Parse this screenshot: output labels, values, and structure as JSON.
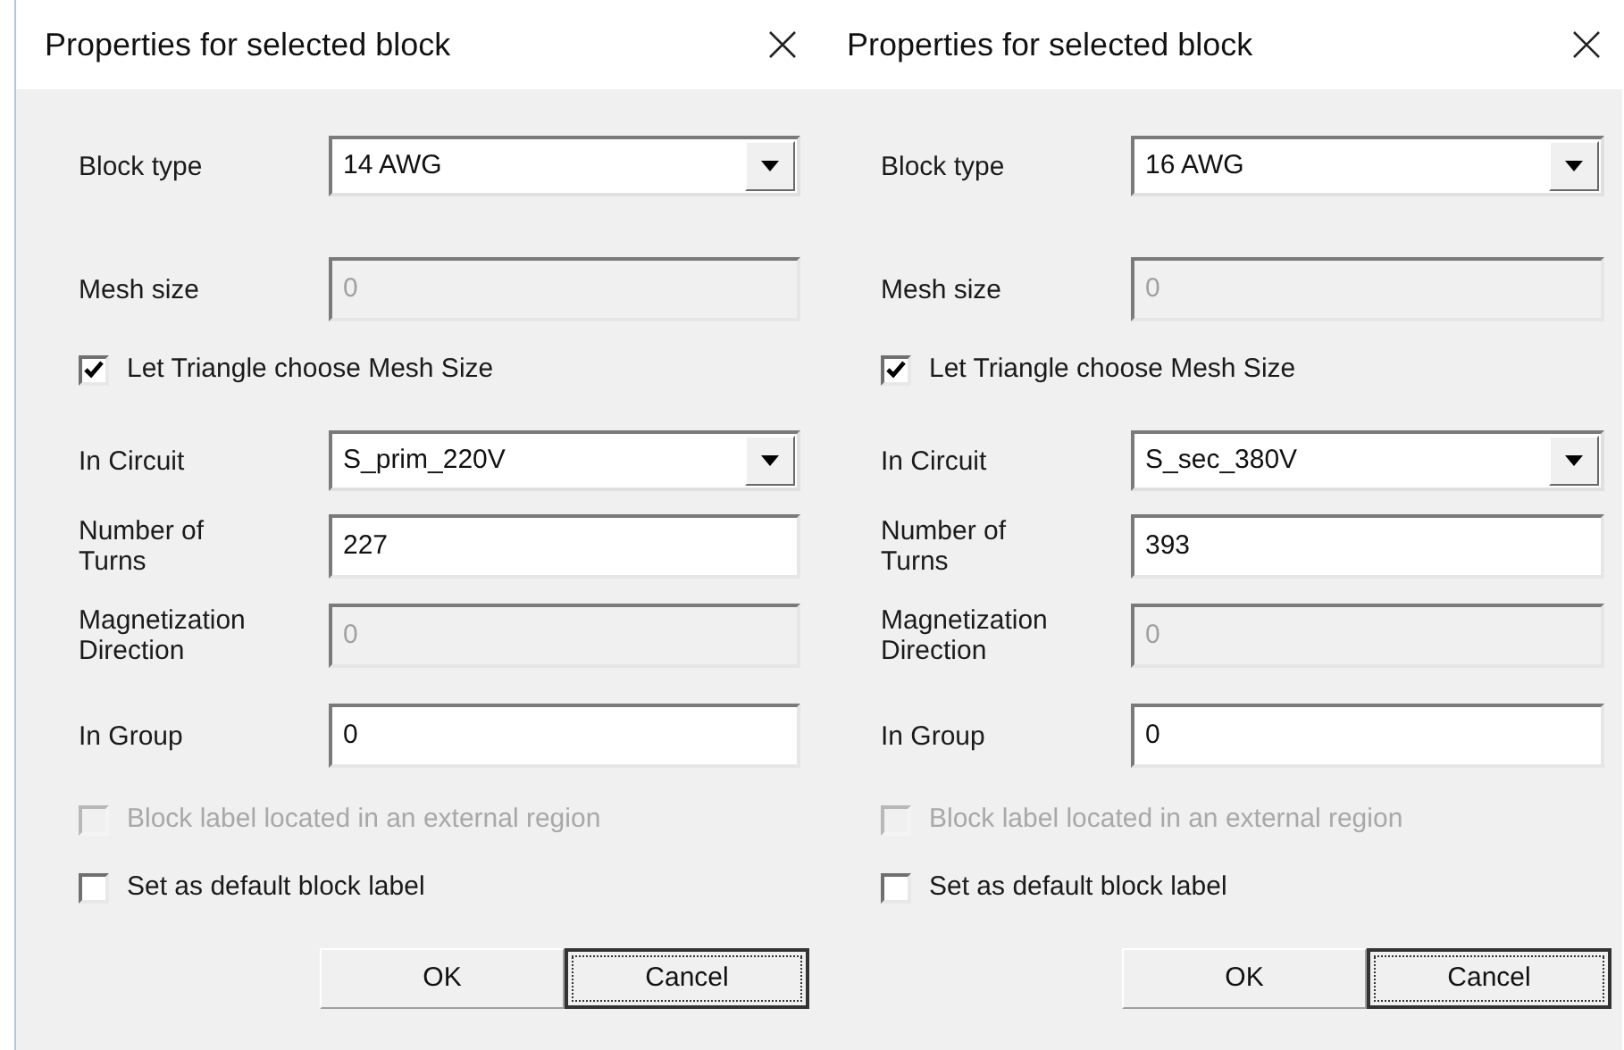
{
  "dialogs": [
    {
      "title": "Properties for selected block",
      "rows": [
        {
          "kind": "select",
          "label": "Block type",
          "value": "14 AWG"
        },
        {
          "kind": "text",
          "label": "Mesh size",
          "value": "0",
          "disabled": true
        },
        {
          "kind": "checkbox",
          "label": "Let Triangle choose Mesh Size",
          "checked": true,
          "disabled": false
        },
        {
          "kind": "select",
          "label": "In Circuit",
          "value": "S_prim_220V"
        },
        {
          "kind": "text",
          "label": "Number of Turns",
          "value": "227",
          "disabled": false
        },
        {
          "kind": "text",
          "label": "Magnetization Direction",
          "value": "0",
          "disabled": true
        },
        {
          "kind": "text",
          "label": "In Group",
          "value": "0",
          "disabled": false
        },
        {
          "kind": "checkbox",
          "label": "Block label located in an external region",
          "checked": false,
          "disabled": true
        },
        {
          "kind": "checkbox",
          "label": "Set as default block label",
          "checked": false,
          "disabled": false
        }
      ],
      "buttons": [
        {
          "label": "OK",
          "focused": false
        },
        {
          "label": "Cancel",
          "focused": true
        }
      ]
    },
    {
      "title": "Properties for selected block",
      "rows": [
        {
          "kind": "select",
          "label": "Block type",
          "value": "16 AWG"
        },
        {
          "kind": "text",
          "label": "Mesh size",
          "value": "0",
          "disabled": true
        },
        {
          "kind": "checkbox",
          "label": "Let Triangle choose Mesh Size",
          "checked": true,
          "disabled": false
        },
        {
          "kind": "select",
          "label": "In Circuit",
          "value": "S_sec_380V"
        },
        {
          "kind": "text",
          "label": "Number of Turns",
          "value": "393",
          "disabled": false
        },
        {
          "kind": "text",
          "label": "Magnetization Direction",
          "value": "0",
          "disabled": true
        },
        {
          "kind": "text",
          "label": "In Group",
          "value": "0",
          "disabled": false
        },
        {
          "kind": "checkbox",
          "label": "Block label located in an external region",
          "checked": false,
          "disabled": true
        },
        {
          "kind": "checkbox",
          "label": "Set as default block label",
          "checked": false,
          "disabled": false
        }
      ],
      "buttons": [
        {
          "label": "OK",
          "focused": false
        },
        {
          "label": "Cancel",
          "focused": true
        }
      ]
    }
  ]
}
